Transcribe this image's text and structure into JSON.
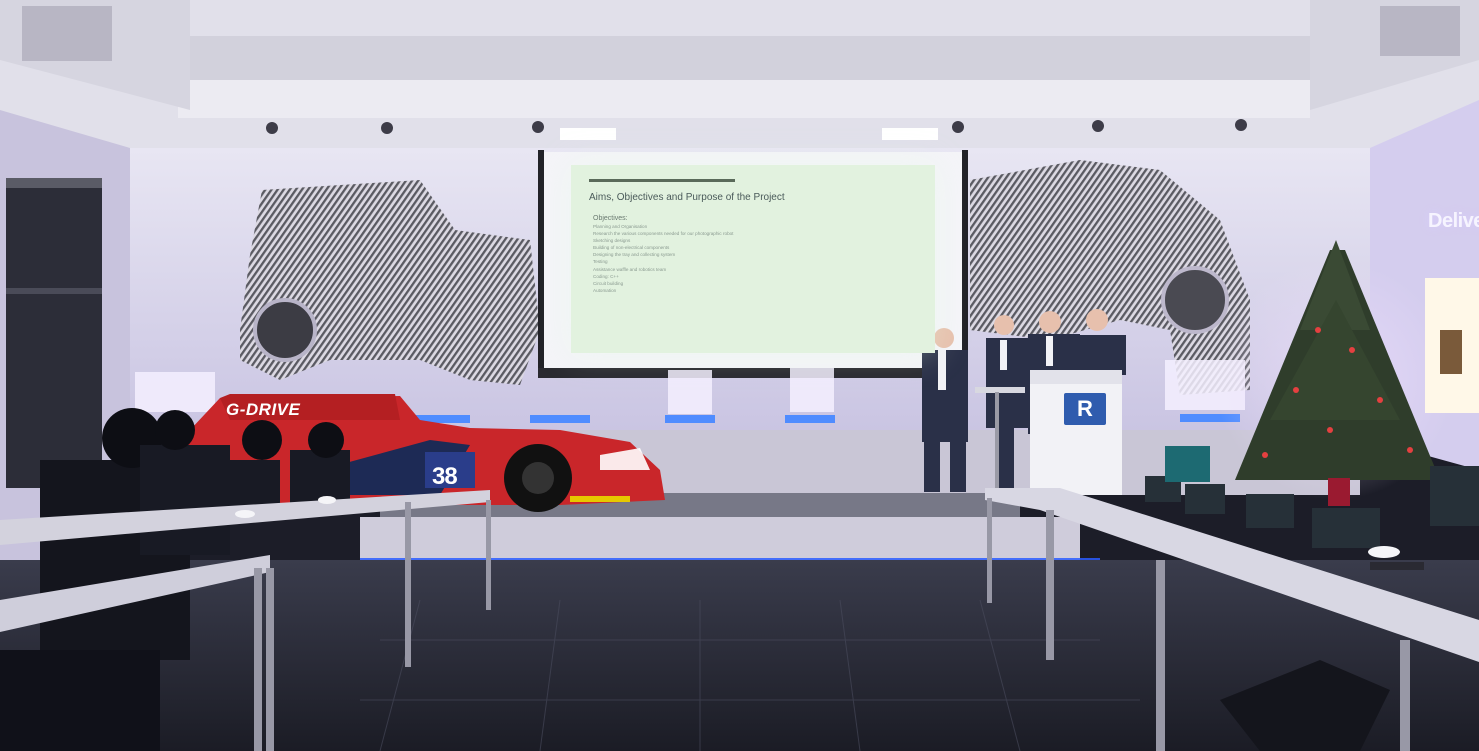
{
  "slide": {
    "title": "Aims, Objectives and Purpose of the Project",
    "objectives_heading": "Objectives:",
    "objectives": [
      "Planning and Organisation",
      "Research the various components needed for our photographic robot",
      "Sketching designs",
      "Building of non-electrical components",
      "Designing the tray and collecting system",
      "Testing",
      "Assistance waffle and robotics team",
      "Coding: C++",
      "Circuit building",
      "Automation"
    ]
  },
  "wall_sign": "Delive",
  "race_car": {
    "brand": "G-DRIVE",
    "number": "38"
  },
  "lectern_logo": "R",
  "colors": {
    "screen": "#e2f2df",
    "car_red": "#c9262a",
    "led_blue": "#2a5cff",
    "lectern_logo": "#2f5cae"
  }
}
